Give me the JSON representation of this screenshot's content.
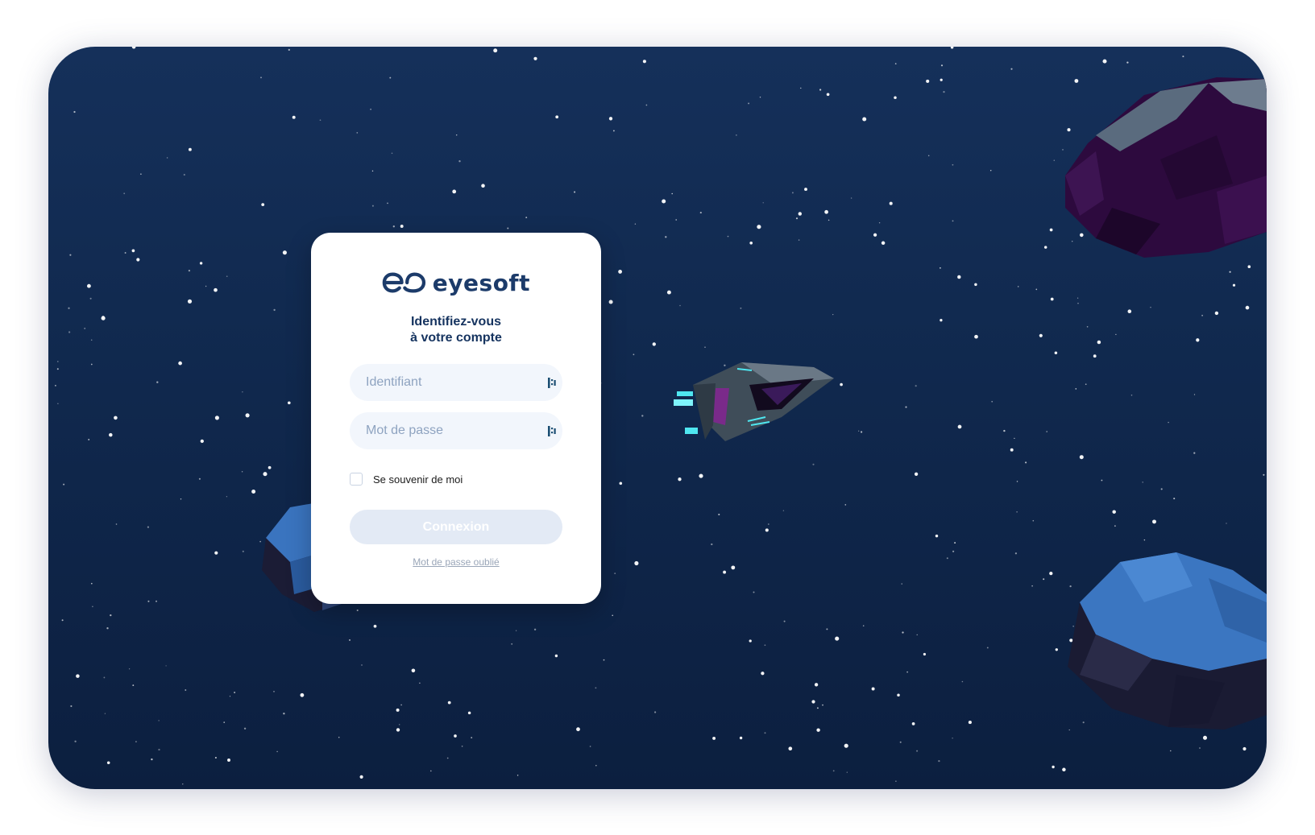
{
  "brand": {
    "name": "eyesoft",
    "color": "#1c3b6a"
  },
  "login": {
    "heading_line1": "Identifiez-vous",
    "heading_line2": "à votre compte",
    "username_placeholder": "Identifiant",
    "password_placeholder": "Mot de passe",
    "remember_label": "Se souvenir de moi",
    "submit_label": "Connexion",
    "forgot_label": "Mot de passe oublié"
  },
  "icons": {
    "username_field": "credential-fill-icon",
    "password_field": "credential-fill-icon"
  },
  "colors": {
    "background": "#112a50",
    "card": "#ffffff",
    "input_bg": "#f2f6fc",
    "button_disabled": "#e3eaf5"
  }
}
